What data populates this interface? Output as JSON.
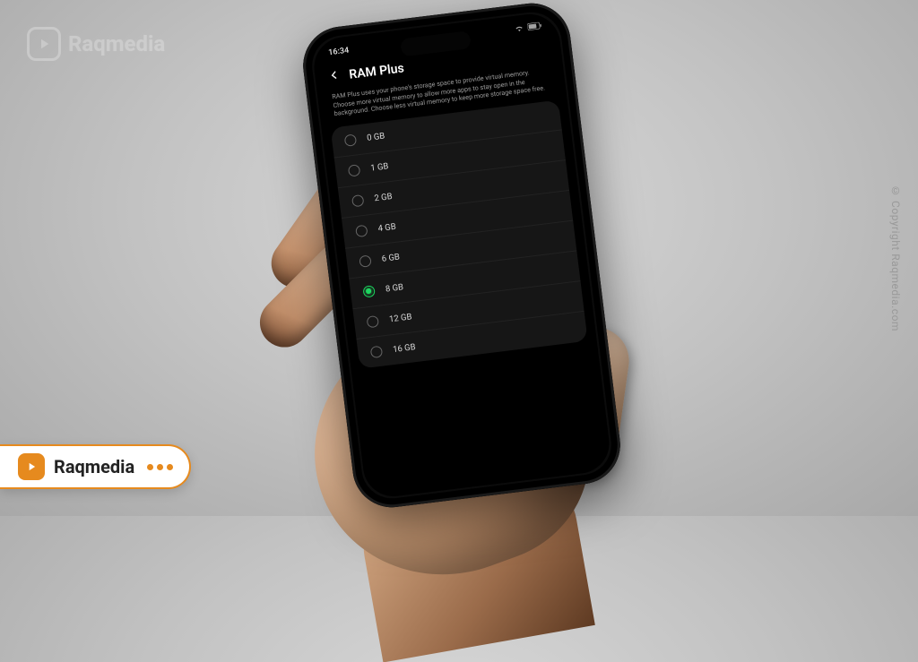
{
  "statusbar": {
    "time": "16:34"
  },
  "header": {
    "title": "RAM Plus"
  },
  "description": "RAM Plus uses your phone's storage space to provide virtual memory. Choose more virtual memory to allow more apps to stay open in the background. Choose less virtual memory to keep more storage space free.",
  "options": [
    {
      "label": "0 GB",
      "selected": false
    },
    {
      "label": "1 GB",
      "selected": false
    },
    {
      "label": "2 GB",
      "selected": false
    },
    {
      "label": "4 GB",
      "selected": false
    },
    {
      "label": "6 GB",
      "selected": false
    },
    {
      "label": "8 GB",
      "selected": true
    },
    {
      "label": "12 GB",
      "selected": false
    },
    {
      "label": "16 GB",
      "selected": false
    }
  ],
  "watermark": {
    "brand": "Raqmedia"
  },
  "copyright": "© Copyright Raqmedia.com",
  "badge": {
    "brand": "Raqmedia"
  },
  "colors": {
    "accent": "#1ed760",
    "brand": "#e68a1e"
  }
}
